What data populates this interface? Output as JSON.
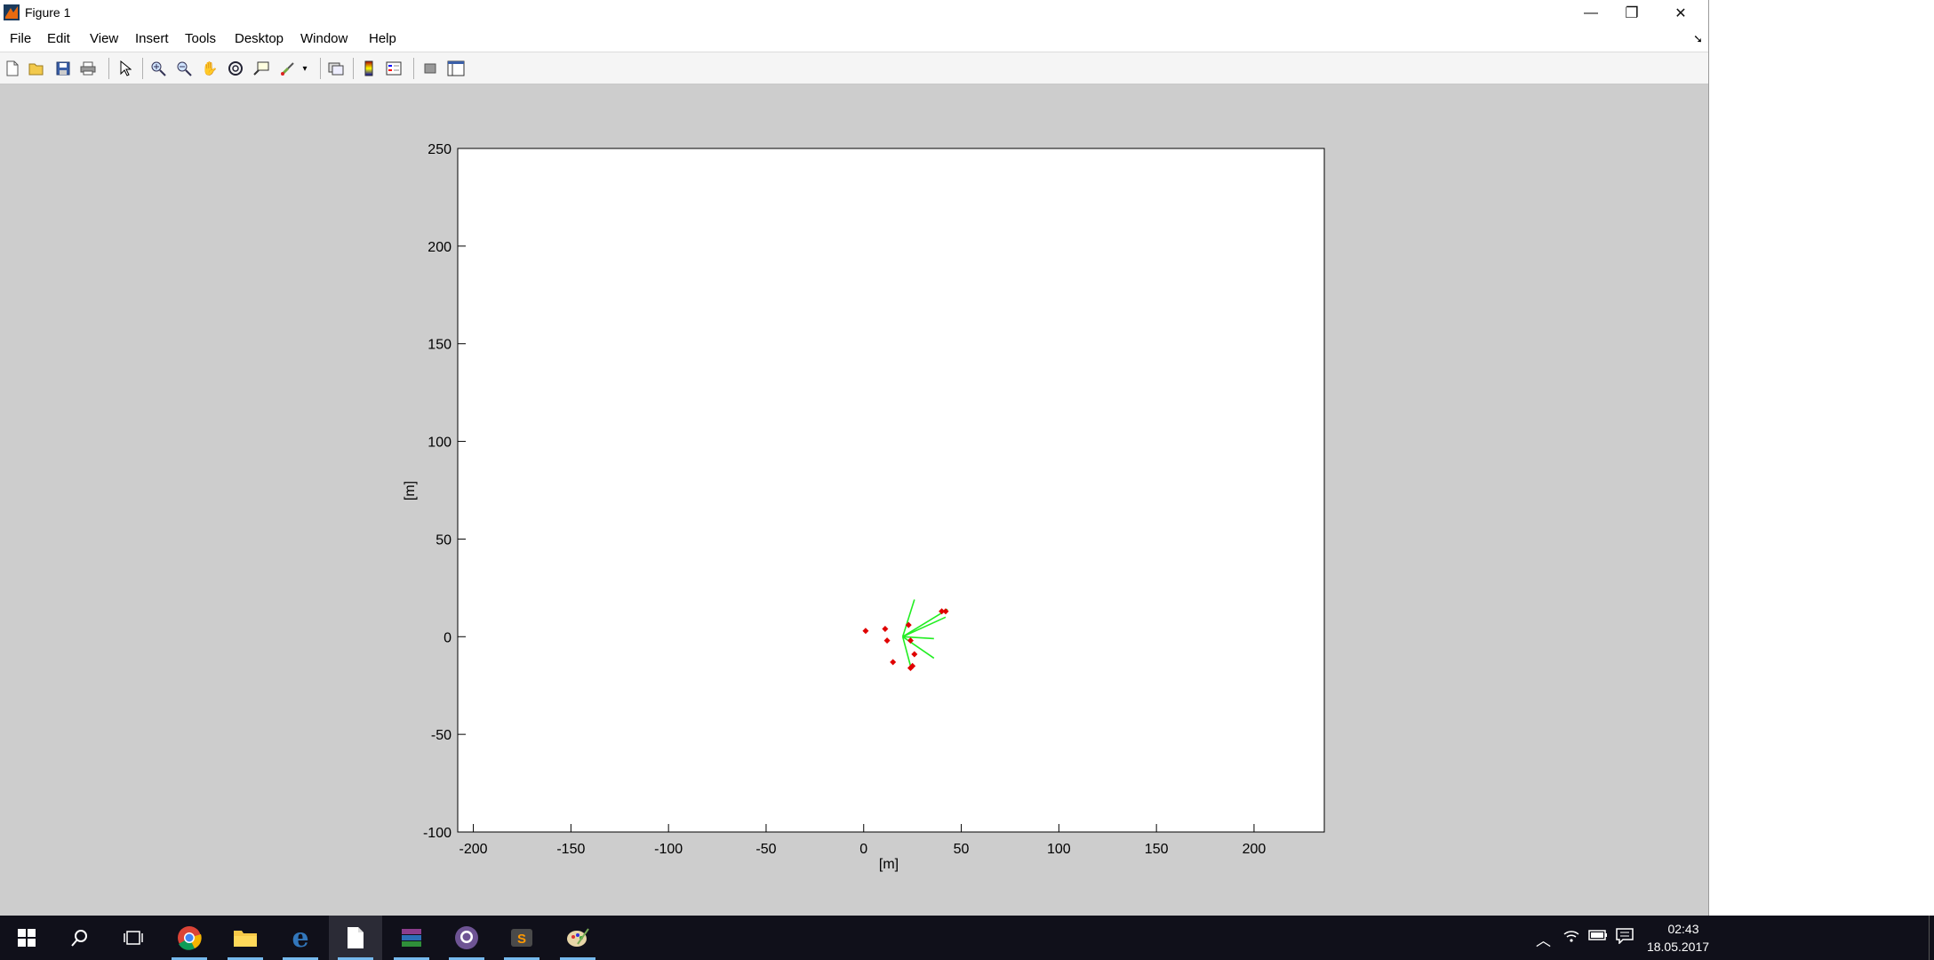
{
  "window": {
    "title": "Figure 1",
    "controls": {
      "minimize": "—",
      "restore": "❐",
      "close": "✕"
    }
  },
  "menu": [
    "File",
    "Edit",
    "View",
    "Insert",
    "Tools",
    "Desktop",
    "Window",
    "Help"
  ],
  "toolbar": [
    {
      "icon": "new-figure-icon"
    },
    {
      "icon": "open-file-icon"
    },
    {
      "icon": "save-icon"
    },
    {
      "icon": "print-icon"
    },
    {
      "icon": "edit-plot-arrow-icon"
    },
    {
      "icon": "zoom-in-icon"
    },
    {
      "icon": "zoom-out-icon"
    },
    {
      "icon": "pan-hand-icon"
    },
    {
      "icon": "rotate-3d-icon"
    },
    {
      "icon": "data-cursor-icon"
    },
    {
      "icon": "brush-icon"
    },
    {
      "icon": "link-plot-icon"
    },
    {
      "icon": "insert-colorbar-icon"
    },
    {
      "icon": "insert-legend-icon"
    },
    {
      "icon": "hide-plot-tools-icon"
    },
    {
      "icon": "show-plot-tools-icon"
    }
  ],
  "chart_data": {
    "type": "scatter",
    "title": "",
    "xlabel": "[m]",
    "ylabel": "[m]",
    "xlim": [
      -208,
      236
    ],
    "ylim": [
      -100,
      250
    ],
    "xticks": [
      -200,
      -150,
      -100,
      -50,
      0,
      50,
      100,
      150,
      200
    ],
    "yticks": [
      -100,
      -50,
      0,
      50,
      100,
      150,
      200,
      250
    ],
    "grid": false,
    "series": [
      {
        "marker": "diamond",
        "color": "#e00000",
        "points": [
          [
            1,
            3
          ],
          [
            11,
            4
          ],
          [
            12,
            -2
          ],
          [
            15,
            -13
          ],
          [
            23,
            6
          ],
          [
            24,
            -2
          ],
          [
            26,
            -9
          ],
          [
            25,
            -15
          ],
          [
            24,
            -16
          ],
          [
            40,
            13
          ],
          [
            42,
            13
          ]
        ]
      }
    ],
    "lines": {
      "color": "#22ee22",
      "origin": [
        20,
        0
      ],
      "ends": [
        [
          26,
          19
        ],
        [
          43,
          14
        ],
        [
          42,
          10
        ],
        [
          36,
          -1
        ],
        [
          36,
          -11
        ],
        [
          24,
          -15
        ]
      ]
    }
  },
  "taskbar": {
    "apps": [
      {
        "icon": "windows-start-icon"
      },
      {
        "icon": "search-icon"
      },
      {
        "icon": "task-view-icon"
      },
      {
        "icon": "chrome-icon"
      },
      {
        "icon": "file-explorer-icon"
      },
      {
        "icon": "edge-icon"
      },
      {
        "icon": "matlab-figure-icon"
      },
      {
        "icon": "winrar-icon"
      },
      {
        "icon": "github-icon"
      },
      {
        "icon": "sublime-text-icon"
      },
      {
        "icon": "paint-icon"
      }
    ],
    "tray": [
      {
        "icon": "chevron-up-icon"
      },
      {
        "icon": "wifi-icon"
      },
      {
        "icon": "battery-icon"
      },
      {
        "icon": "action-center-icon"
      }
    ],
    "time": "02:43",
    "date": "18.05.2017"
  },
  "colors": {
    "figure_bg": "#cdcdcd",
    "axes_bg": "#ffffff",
    "marker": "#e00000",
    "lines": "#22ee22",
    "taskbar": "#10101a"
  }
}
